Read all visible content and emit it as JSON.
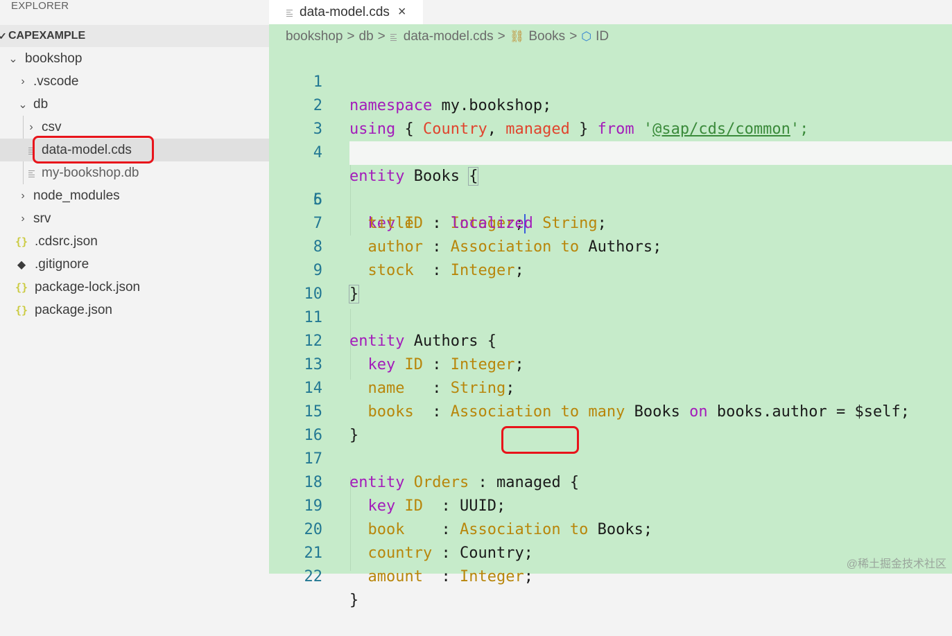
{
  "sidebar": {
    "title": "EXPLORER",
    "section": "CAPEXAMPLE",
    "items": [
      {
        "label": "bookshop",
        "kind": "folder",
        "expanded": true
      },
      {
        "label": ".vscode",
        "kind": "folder",
        "expanded": false
      },
      {
        "label": "db",
        "kind": "folder",
        "expanded": true
      },
      {
        "label": "csv",
        "kind": "folder",
        "expanded": false
      },
      {
        "label": "data-model.cds",
        "kind": "file",
        "selected": true
      },
      {
        "label": "my-bookshop.db",
        "kind": "file"
      },
      {
        "label": "node_modules",
        "kind": "folder",
        "expanded": false
      },
      {
        "label": "srv",
        "kind": "folder",
        "expanded": false
      },
      {
        "label": ".cdsrc.json",
        "kind": "json"
      },
      {
        "label": ".gitignore",
        "kind": "git"
      },
      {
        "label": "package-lock.json",
        "kind": "json"
      },
      {
        "label": "package.json",
        "kind": "json"
      }
    ]
  },
  "tab": {
    "label": "data-model.cds",
    "close_glyph": "×"
  },
  "breadcrumb": {
    "parts": [
      "bookshop",
      "db",
      "data-model.cds",
      "Books",
      "ID"
    ],
    "separator": ">"
  },
  "editor": {
    "line_numbers": [
      "1",
      "2",
      "3",
      "4",
      "5",
      "6",
      "7",
      "8",
      "9",
      "10",
      "11",
      "12",
      "13",
      "14",
      "15",
      "16",
      "17",
      "18",
      "19",
      "20",
      "21",
      "22"
    ],
    "current_line": 5,
    "colors": {
      "background": "#c6ebca",
      "keyword": "#a31cba",
      "type": "#b8860b",
      "string": "#3a8a3a",
      "name_red": "#e0442d",
      "line_number": "#237893",
      "highlight_border": "#e8141b"
    },
    "code": {
      "l1": {
        "kw": "namespace",
        "rest": " my.bookshop;"
      },
      "l2": {
        "kw1": "using",
        "p1": " { ",
        "n1": "Country",
        "p2": ", ",
        "n2": "managed",
        "p3": " } ",
        "kw2": "from",
        "p4": " '",
        "str": "@sap/cds/common",
        "p5": "';"
      },
      "l4": {
        "kw": "entity",
        "name": " Books ",
        "brace": "{"
      },
      "l5": {
        "indent": "  ",
        "kw": "key",
        "sp": " ",
        "f": "ID",
        "p": " : ",
        "t": "Integer",
        "end": ";"
      },
      "l6": {
        "indent": "  ",
        "f": "title",
        "p": "  : ",
        "kw": "localized",
        "sp": " ",
        "t": "String",
        "end": ";"
      },
      "l7": {
        "indent": "  ",
        "f": "author",
        "p": " : ",
        "t": "Association to",
        "rest": " Authors;"
      },
      "l8": {
        "indent": "  ",
        "f": "stock",
        "p": "  : ",
        "t": "Integer",
        "end": ";"
      },
      "l9": {
        "brace": "}"
      },
      "l11": {
        "kw": "entity",
        "name": " Authors {"
      },
      "l12": {
        "indent": "  ",
        "kw": "key",
        "sp": " ",
        "f": "ID",
        "p": " : ",
        "t": "Integer",
        "end": ";"
      },
      "l13": {
        "indent": "  ",
        "f": "name",
        "p": "   : ",
        "t": "String",
        "end": ";"
      },
      "l14": {
        "indent": "  ",
        "f": "books",
        "p": "  : ",
        "t": "Association to many",
        "mid": " Books ",
        "kw": "on",
        "rest": " books.author = $self;"
      },
      "l15": {
        "brace": "}"
      },
      "l17": {
        "kw": "entity",
        "sp": " ",
        "name": "Orders",
        "p": " : ",
        "managed": "managed",
        "rest": " {"
      },
      "l18": {
        "indent": "  ",
        "kw": "key",
        "sp": " ",
        "f": "ID",
        "p": "  : ",
        "rest": "UUID;"
      },
      "l19": {
        "indent": "  ",
        "f": "book",
        "p": "    : ",
        "t": "Association to",
        "rest": " Books;"
      },
      "l20": {
        "indent": "  ",
        "f": "country",
        "p": " : ",
        "rest": "Country;"
      },
      "l21": {
        "indent": "  ",
        "f": "amount",
        "p": "  : ",
        "t": "Integer",
        "end": ";"
      },
      "l22": {
        "brace": "}"
      }
    }
  },
  "watermark": "@稀土掘金技术社区"
}
